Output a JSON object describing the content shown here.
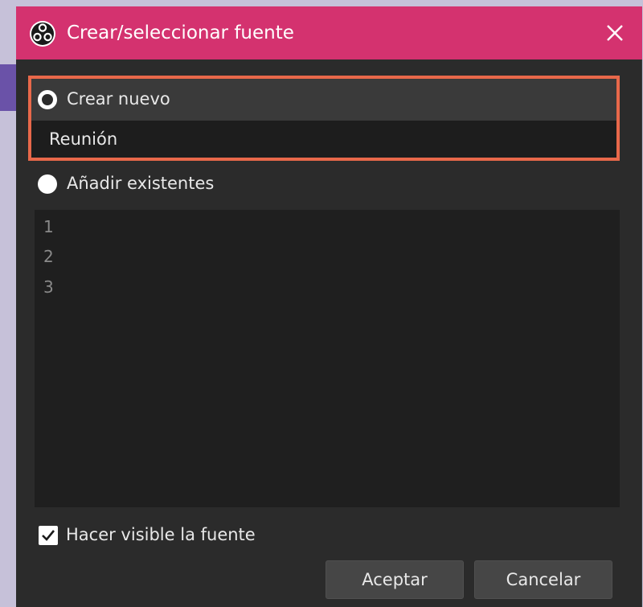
{
  "dialog": {
    "title": "Crear/seleccionar fuente",
    "icon": "obs-logo-icon",
    "accent_color": "#d4326f",
    "highlight_color": "#e8684a"
  },
  "create_new": {
    "label": "Crear nuevo",
    "selected": true,
    "name_value": "Reunión"
  },
  "add_existing": {
    "label": "Añadir existentes",
    "selected": false,
    "items": [
      "1",
      "2",
      "3"
    ]
  },
  "visible_checkbox": {
    "label": "Hacer visible la fuente",
    "checked": true
  },
  "buttons": {
    "ok": "Aceptar",
    "cancel": "Cancelar"
  }
}
